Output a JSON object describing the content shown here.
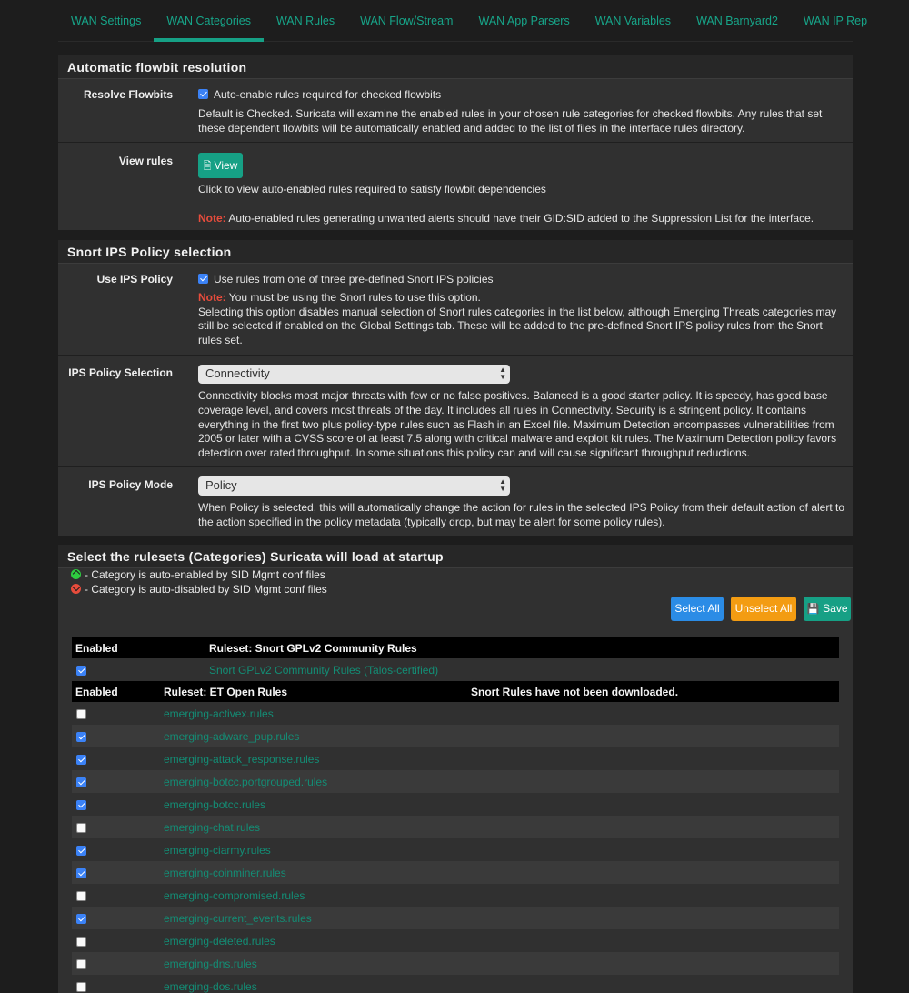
{
  "tabs": [
    {
      "label": "WAN Settings",
      "active": false
    },
    {
      "label": "WAN Categories",
      "active": true
    },
    {
      "label": "WAN Rules",
      "active": false
    },
    {
      "label": "WAN Flow/Stream",
      "active": false
    },
    {
      "label": "WAN App Parsers",
      "active": false
    },
    {
      "label": "WAN Variables",
      "active": false
    },
    {
      "label": "WAN Barnyard2",
      "active": false
    },
    {
      "label": "WAN IP Rep",
      "active": false
    }
  ],
  "flowbit": {
    "heading": "Automatic flowbit resolution",
    "resolve_label": "Resolve Flowbits",
    "resolve_checkbox_label": "Auto-enable rules required for checked flowbits",
    "resolve_help": "Default is Checked. Suricata will examine the enabled rules in your chosen rule categories for checked flowbits. Any rules that set these dependent flowbits will be automatically enabled and added to the list of files in the interface rules directory.",
    "view_label": "View rules",
    "view_button": "View",
    "view_help": "Click to view auto-enabled rules required to satisfy flowbit dependencies",
    "note_prefix": "Note:",
    "note_text": "Auto-enabled rules generating unwanted alerts should have their GID:SID added to the Suppression List for the interface."
  },
  "ips": {
    "heading": "Snort IPS Policy selection",
    "use_label": "Use IPS Policy",
    "use_checkbox_label": "Use rules from one of three pre-defined Snort IPS policies",
    "note_prefix": "Note:",
    "note_text": "You must be using the Snort rules to use this option.",
    "use_help": "Selecting this option disables manual selection of Snort rules categories in the list below, although Emerging Threats categories may still be selected if enabled on the Global Settings tab. These will be added to the pre-defined Snort IPS policy rules from the Snort rules set.",
    "selection_label": "IPS Policy Selection",
    "selection_value": "Connectivity",
    "selection_help": "Connectivity blocks most major threats with few or no false positives. Balanced is a good starter policy. It is speedy, has good base coverage level, and covers most threats of the day. It includes all rules in Connectivity. Security is a stringent policy. It contains everything in the first two plus policy-type rules such as Flash in an Excel file. Maximum Detection encompasses vulnerabilities from 2005 or later with a CVSS score of at least 7.5 along with critical malware and exploit kit rules. The Maximum Detection policy favors detection over rated throughput. In some situations this policy can and will cause significant throughput reductions.",
    "mode_label": "IPS Policy Mode",
    "mode_value": "Policy",
    "mode_help": "When Policy is selected, this will automatically change the action for rules in the selected IPS Policy from their default action of alert to the action specified in the policy metadata (typically drop, but may be alert for some policy rules)."
  },
  "rulesets": {
    "heading": "Select the rulesets (Categories) Suricata will load at startup",
    "legend_enabled": "- Category is auto-enabled by SID Mgmt conf files",
    "legend_disabled": "- Category is auto-disabled by SID Mgmt conf files",
    "select_all": "Select All",
    "unselect_all": "Unselect All",
    "save": "Save",
    "snort_header": {
      "enabled": "Enabled",
      "ruleset": "Ruleset: Snort GPLv2 Community Rules"
    },
    "snort_rule": {
      "name": "Snort GPLv2 Community Rules (Talos-certified)",
      "checked": true
    },
    "et_header": {
      "enabled": "Enabled",
      "ruleset": "Ruleset: ET Open Rules",
      "snort_status": "Snort Rules have not been downloaded."
    },
    "et_rules": [
      {
        "name": "emerging-activex.rules",
        "checked": false
      },
      {
        "name": "emerging-adware_pup.rules",
        "checked": true
      },
      {
        "name": "emerging-attack_response.rules",
        "checked": true
      },
      {
        "name": "emerging-botcc.portgrouped.rules",
        "checked": true
      },
      {
        "name": "emerging-botcc.rules",
        "checked": true
      },
      {
        "name": "emerging-chat.rules",
        "checked": false
      },
      {
        "name": "emerging-ciarmy.rules",
        "checked": true
      },
      {
        "name": "emerging-coinminer.rules",
        "checked": true
      },
      {
        "name": "emerging-compromised.rules",
        "checked": false
      },
      {
        "name": "emerging-current_events.rules",
        "checked": true
      },
      {
        "name": "emerging-deleted.rules",
        "checked": false
      },
      {
        "name": "emerging-dns.rules",
        "checked": false
      },
      {
        "name": "emerging-dos.rules",
        "checked": false
      }
    ]
  },
  "colors": {
    "accent": "#16a085",
    "select_all": "#2b8ce6",
    "unselect_all": "#f39c12",
    "note": "#e74c3c"
  }
}
